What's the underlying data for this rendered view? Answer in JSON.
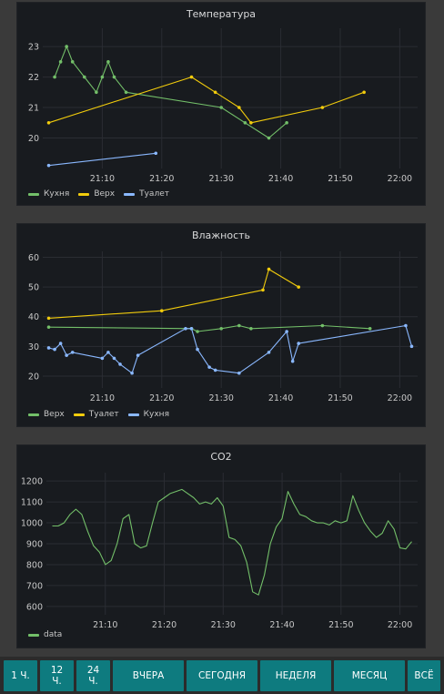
{
  "colors": {
    "green": "#73bf69",
    "yellow": "#f2cc0c",
    "blue": "#8ab8ff",
    "panel_bg": "#181b1f",
    "page_bg": "#3a3a3a",
    "button_bg": "#0e7b7f"
  },
  "panels": [
    {
      "title": "Температура",
      "legend": [
        "Кухня",
        "Верх",
        "Туалет"
      ]
    },
    {
      "title": "Влажность",
      "legend": [
        "Верх",
        "Туалет",
        "Кухня"
      ]
    },
    {
      "title": "CO2",
      "legend": [
        "data"
      ]
    }
  ],
  "buttons": [
    "1 Ч.",
    "12 Ч.",
    "24 Ч.",
    "ВЧЕРА",
    "СЕГОДНЯ",
    "НЕДЕЛЯ",
    "МЕСЯЦ",
    "ВСЁ"
  ],
  "chart_data": [
    {
      "type": "line",
      "title": "Температура",
      "x_ticks": [
        "21:10",
        "21:20",
        "21:30",
        "21:40",
        "21:50",
        "22:00"
      ],
      "y_ticks": [
        20,
        21,
        22,
        23
      ],
      "xlim": [
        "21:00",
        "22:03"
      ],
      "ylim": [
        19.0,
        23.6
      ],
      "grid": true,
      "legend_position": "bottom-left",
      "series": [
        {
          "name": "Кухня",
          "color": "#73bf69",
          "markers": true,
          "points": [
            [
              "21:02",
              22.0
            ],
            [
              "21:03",
              22.5
            ],
            [
              "21:04",
              23.0
            ],
            [
              "21:05",
              22.5
            ],
            [
              "21:07",
              22.0
            ],
            [
              "21:09",
              21.5
            ],
            [
              "21:10",
              22.0
            ],
            [
              "21:11",
              22.5
            ],
            [
              "21:12",
              22.0
            ],
            [
              "21:14",
              21.5
            ],
            [
              "21:30",
              21.0
            ],
            [
              "21:34",
              20.5
            ],
            [
              "21:38",
              20.0
            ],
            [
              "21:41",
              20.5
            ]
          ]
        },
        {
          "name": "Верх",
          "color": "#f2cc0c",
          "markers": true,
          "points": [
            [
              "21:01",
              20.5
            ],
            [
              "21:25",
              22.0
            ],
            [
              "21:29",
              21.5
            ],
            [
              "21:33",
              21.0
            ],
            [
              "21:35",
              20.5
            ],
            [
              "21:47",
              21.0
            ],
            [
              "21:54",
              21.5
            ]
          ]
        },
        {
          "name": "Туалет",
          "color": "#8ab8ff",
          "markers": true,
          "points": [
            [
              "21:01",
              19.1
            ],
            [
              "21:19",
              19.5
            ]
          ]
        }
      ]
    },
    {
      "type": "line",
      "title": "Влажность",
      "x_ticks": [
        "21:10",
        "21:20",
        "21:30",
        "21:40",
        "21:50",
        "22:00"
      ],
      "y_ticks": [
        20,
        30,
        40,
        50,
        60
      ],
      "xlim": [
        "21:00",
        "22:03"
      ],
      "ylim": [
        16,
        62
      ],
      "grid": true,
      "legend_position": "bottom-left",
      "series": [
        {
          "name": "Верх",
          "color": "#73bf69",
          "markers": true,
          "points": [
            [
              "21:01",
              36.5
            ],
            [
              "21:25",
              36
            ],
            [
              "21:26",
              35
            ],
            [
              "21:30",
              36
            ],
            [
              "21:33",
              37
            ],
            [
              "21:35",
              36
            ],
            [
              "21:47",
              37
            ],
            [
              "21:55",
              36
            ]
          ]
        },
        {
          "name": "Туалет",
          "color": "#f2cc0c",
          "markers": true,
          "points": [
            [
              "21:01",
              39.5
            ],
            [
              "21:20",
              42
            ],
            [
              "21:37",
              49
            ],
            [
              "21:38",
              56
            ],
            [
              "21:43",
              50
            ]
          ]
        },
        {
          "name": "Кухня",
          "color": "#8ab8ff",
          "markers": true,
          "points": [
            [
              "21:01",
              29.5
            ],
            [
              "21:02",
              29
            ],
            [
              "21:03",
              31
            ],
            [
              "21:04",
              27
            ],
            [
              "21:05",
              28
            ],
            [
              "21:10",
              26
            ],
            [
              "21:11",
              28
            ],
            [
              "21:12",
              26
            ],
            [
              "21:13",
              24
            ],
            [
              "21:15",
              21
            ],
            [
              "21:16",
              27
            ],
            [
              "21:24",
              36
            ],
            [
              "21:25",
              36
            ],
            [
              "21:26",
              29
            ],
            [
              "21:28",
              23
            ],
            [
              "21:29",
              22
            ],
            [
              "21:33",
              21
            ],
            [
              "21:38",
              28
            ],
            [
              "21:41",
              35
            ],
            [
              "21:42",
              25
            ],
            [
              "21:43",
              31
            ],
            [
              "22:01",
              37
            ],
            [
              "22:02",
              30
            ]
          ]
        }
      ]
    },
    {
      "type": "line",
      "title": "CO2",
      "x_ticks": [
        "21:10",
        "21:20",
        "21:30",
        "21:40",
        "21:50",
        "22:00"
      ],
      "y_ticks": [
        600,
        700,
        800,
        900,
        1000,
        1100,
        1200
      ],
      "xlim": [
        "21:00",
        "22:03"
      ],
      "ylim": [
        560,
        1240
      ],
      "grid": true,
      "legend_position": "bottom-left",
      "series": [
        {
          "name": "data",
          "color": "#73bf69",
          "markers": false,
          "points": [
            [
              "21:01",
              985
            ],
            [
              "21:02",
              985
            ],
            [
              "21:03",
              1000
            ],
            [
              "21:04",
              1040
            ],
            [
              "21:05",
              1065
            ],
            [
              "21:06",
              1040
            ],
            [
              "21:07",
              960
            ],
            [
              "21:08",
              890
            ],
            [
              "21:09",
              860
            ],
            [
              "21:10",
              800
            ],
            [
              "21:11",
              820
            ],
            [
              "21:12",
              900
            ],
            [
              "21:13",
              1020
            ],
            [
              "21:14",
              1040
            ],
            [
              "21:15",
              900
            ],
            [
              "21:16",
              880
            ],
            [
              "21:17",
              890
            ],
            [
              "21:18",
              1000
            ],
            [
              "21:19",
              1100
            ],
            [
              "21:20",
              1120
            ],
            [
              "21:21",
              1140
            ],
            [
              "21:22",
              1150
            ],
            [
              "21:23",
              1160
            ],
            [
              "21:24",
              1140
            ],
            [
              "21:25",
              1120
            ],
            [
              "21:26",
              1090
            ],
            [
              "21:27",
              1100
            ],
            [
              "21:28",
              1090
            ],
            [
              "21:29",
              1120
            ],
            [
              "21:30",
              1080
            ],
            [
              "21:31",
              930
            ],
            [
              "21:32",
              920
            ],
            [
              "21:33",
              890
            ],
            [
              "21:34",
              810
            ],
            [
              "21:35",
              670
            ],
            [
              "21:36",
              655
            ],
            [
              "21:37",
              750
            ],
            [
              "21:38",
              900
            ],
            [
              "21:39",
              980
            ],
            [
              "21:40",
              1020
            ],
            [
              "21:41",
              1150
            ],
            [
              "21:42",
              1090
            ],
            [
              "21:43",
              1040
            ],
            [
              "21:44",
              1030
            ],
            [
              "21:45",
              1010
            ],
            [
              "21:46",
              1000
            ],
            [
              "21:47",
              1000
            ],
            [
              "21:48",
              990
            ],
            [
              "21:49",
              1010
            ],
            [
              "21:50",
              1000
            ],
            [
              "21:51",
              1010
            ],
            [
              "21:52",
              1130
            ],
            [
              "21:53",
              1060
            ],
            [
              "21:54",
              1000
            ],
            [
              "21:55",
              960
            ],
            [
              "21:56",
              930
            ],
            [
              "21:57",
              950
            ],
            [
              "21:58",
              1010
            ],
            [
              "21:59",
              970
            ],
            [
              "22:00",
              880
            ],
            [
              "22:01",
              875
            ],
            [
              "22:02",
              910
            ]
          ]
        }
      ]
    }
  ]
}
